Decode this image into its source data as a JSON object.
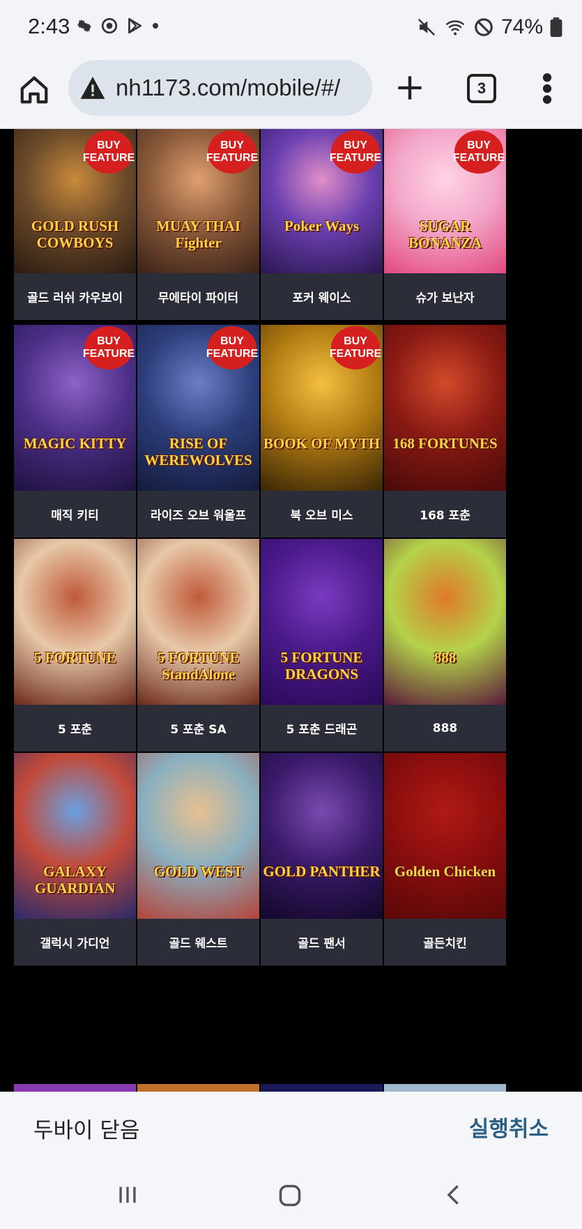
{
  "status_bar": {
    "time": "2:43",
    "battery_percent": "74%",
    "left_icons": [
      "gear-icon",
      "sync-icon",
      "play-store-icon",
      "dot-icon"
    ],
    "right_icons": [
      "mute-icon",
      "wifi-icon",
      "no-disturb-icon",
      "battery-icon"
    ]
  },
  "browser": {
    "url": "nh1173.com/mobile/#/",
    "tab_count": "3"
  },
  "games": [
    {
      "label": "골드 러쉬 카우보이",
      "art_title": "GOLD RUSH COWBOYS",
      "buy_feature": true,
      "art_colors": [
        "#6b4a2a",
        "#c98a3c",
        "#2b1b10"
      ]
    },
    {
      "label": "무에타이 파이터",
      "art_title": "MUAY THAI Fighter",
      "buy_feature": true,
      "art_colors": [
        "#8a5a3a",
        "#e0a070",
        "#3a2218"
      ]
    },
    {
      "label": "포커 웨이스",
      "art_title": "Poker Ways",
      "buy_feature": true,
      "art_colors": [
        "#6a3fb0",
        "#e08ec8",
        "#2a1650"
      ]
    },
    {
      "label": "슈가 보난자",
      "art_title": "SUGAR BONANZA",
      "buy_feature": true,
      "art_colors": [
        "#f3a6c8",
        "#ffd3e6",
        "#e2487e"
      ]
    },
    {
      "label": "매직 키티",
      "art_title": "MAGIC KITTY",
      "buy_feature": true,
      "art_colors": [
        "#4b2e86",
        "#8c62c6",
        "#1f1340"
      ]
    },
    {
      "label": "라이즈 오브 워울프",
      "art_title": "RISE OF WEREWOLVES",
      "buy_feature": true,
      "art_colors": [
        "#2c3d7a",
        "#6b7fc6",
        "#141c3c"
      ]
    },
    {
      "label": "북 오브 미스",
      "art_title": "BOOK OF MYTH",
      "buy_feature": true,
      "art_colors": [
        "#b07a12",
        "#f4c040",
        "#3a2606"
      ]
    },
    {
      "label": "168 포춘",
      "art_title": "168 FORTUNES",
      "buy_feature": false,
      "art_colors": [
        "#8a1a14",
        "#d24a2a",
        "#4a0a08"
      ]
    },
    {
      "label": "5 포춘",
      "art_title": "5 FORTUNE",
      "buy_feature": false,
      "art_colors": [
        "#e7c8a8",
        "#c05a3a",
        "#6b2a1a"
      ]
    },
    {
      "label": "5 포춘 SA",
      "art_title": "5 FORTUNE StandAlone",
      "buy_feature": false,
      "art_colors": [
        "#e7c8a8",
        "#c05a3a",
        "#6b2a1a"
      ]
    },
    {
      "label": "5 포춘 드래곤",
      "art_title": "5 FORTUNE DRAGONS",
      "buy_feature": false,
      "art_colors": [
        "#4a1a8a",
        "#7a3ac0",
        "#2a0a5a"
      ]
    },
    {
      "label": "888",
      "art_title": "888",
      "buy_feature": false,
      "art_colors": [
        "#b4d24a",
        "#e07a2a",
        "#5a1a3a"
      ]
    },
    {
      "label": "갤럭시 가디언",
      "art_title": "GALAXY GUARDIAN",
      "buy_feature": false,
      "art_colors": [
        "#c24a3a",
        "#6aa0e0",
        "#2a2a6a"
      ]
    },
    {
      "label": "골드 웨스트",
      "art_title": "GOLD WEST",
      "buy_feature": false,
      "art_colors": [
        "#8ab0c0",
        "#e8c090",
        "#b4443a"
      ]
    },
    {
      "label": "골드 팬서",
      "art_title": "GOLD PANTHER",
      "buy_feature": false,
      "art_colors": [
        "#3a1a6a",
        "#7a4ab0",
        "#12082a"
      ]
    },
    {
      "label": "골든치킨",
      "art_title": "Golden Chicken",
      "buy_feature": false,
      "art_colors": [
        "#8a0e0e",
        "#b01a14",
        "#5a0808"
      ]
    }
  ],
  "buy_badge": {
    "line1": "BUY",
    "line2": "FEATURE"
  },
  "next_row_colors": [
    "#8a3ab0",
    "#c0702a",
    "#1a1a5a",
    "#a0b8d0"
  ],
  "snackbar": {
    "message": "두바이 닫음",
    "action": "실행취소"
  },
  "nav": {
    "icons": [
      "recents-icon",
      "home-icon",
      "back-icon"
    ]
  }
}
